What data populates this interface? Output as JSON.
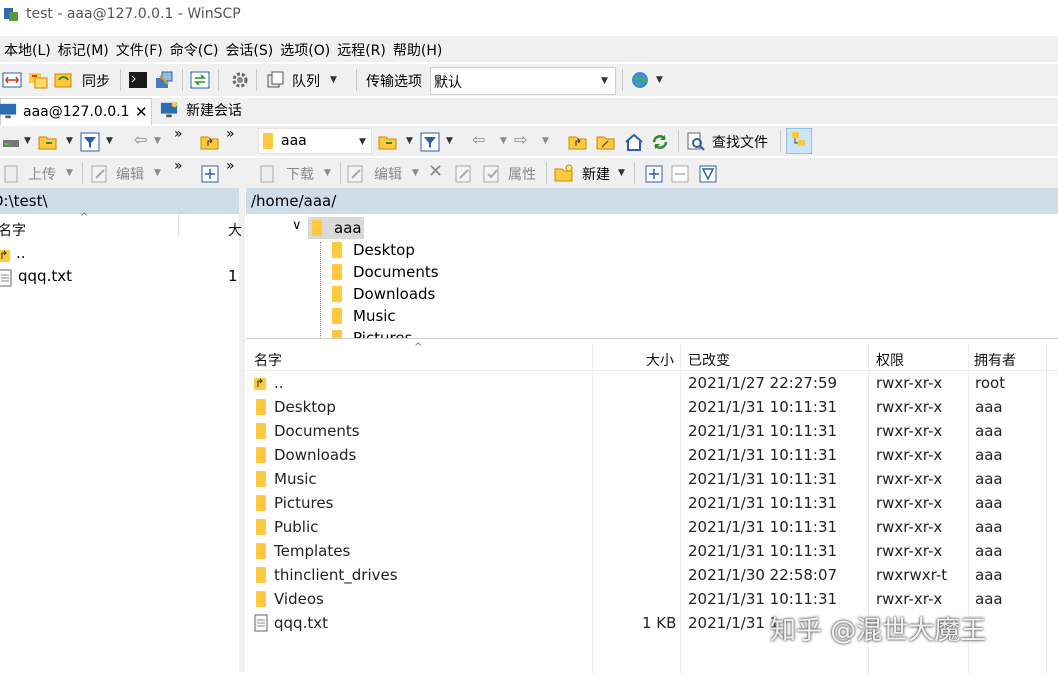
{
  "window": {
    "title": "test - aaa@127.0.0.1 - WinSCP"
  },
  "menu": [
    "本地(L)",
    "标记(M)",
    "文件(F)",
    "命令(C)",
    "会话(S)",
    "选项(O)",
    "远程(R)",
    "帮助(H)"
  ],
  "toolbar": {
    "sync_label": "同步",
    "queue_label": "队列",
    "transfer_label": "传输选项",
    "transfer_value": "默认"
  },
  "tabs": {
    "session": "aaa@127.0.0.1",
    "new_session": "新建会话"
  },
  "left_toolbar": {
    "upload": "上传",
    "edit": "编辑"
  },
  "right_toolbar": {
    "dir_value": "aaa",
    "find_files": "查找文件",
    "download": "下载",
    "edit": "编辑",
    "properties": "属性",
    "new": "新建"
  },
  "left_panel": {
    "path": "D:\\test\\",
    "col_name": "名字",
    "col_size_partial": "大",
    "rows": [
      {
        "name": "..",
        "size": ""
      },
      {
        "name": "qqq.txt",
        "size": "1"
      }
    ]
  },
  "tree": {
    "root": "aaa",
    "children": [
      "Desktop",
      "Documents",
      "Downloads",
      "Music",
      "Pictures"
    ]
  },
  "right_panel": {
    "path": "/home/aaa/",
    "columns": {
      "name": "名字",
      "size": "大小",
      "changed": "已改变",
      "rights": "权限",
      "owner": "拥有者"
    },
    "rows": [
      {
        "name": "..",
        "size": "",
        "changed": "2021/1/27 22:27:59",
        "rights": "rwxr-xr-x",
        "owner": "root"
      },
      {
        "name": "Desktop",
        "size": "",
        "changed": "2021/1/31 10:11:31",
        "rights": "rwxr-xr-x",
        "owner": "aaa"
      },
      {
        "name": "Documents",
        "size": "",
        "changed": "2021/1/31 10:11:31",
        "rights": "rwxr-xr-x",
        "owner": "aaa"
      },
      {
        "name": "Downloads",
        "size": "",
        "changed": "2021/1/31 10:11:31",
        "rights": "rwxr-xr-x",
        "owner": "aaa"
      },
      {
        "name": "Music",
        "size": "",
        "changed": "2021/1/31 10:11:31",
        "rights": "rwxr-xr-x",
        "owner": "aaa"
      },
      {
        "name": "Pictures",
        "size": "",
        "changed": "2021/1/31 10:11:31",
        "rights": "rwxr-xr-x",
        "owner": "aaa"
      },
      {
        "name": "Public",
        "size": "",
        "changed": "2021/1/31 10:11:31",
        "rights": "rwxr-xr-x",
        "owner": "aaa"
      },
      {
        "name": "Templates",
        "size": "",
        "changed": "2021/1/31 10:11:31",
        "rights": "rwxr-xr-x",
        "owner": "aaa"
      },
      {
        "name": "thinclient_drives",
        "size": "",
        "changed": "2021/1/30 22:58:07",
        "rights": "rwxrwxr-t",
        "owner": "aaa"
      },
      {
        "name": "Videos",
        "size": "",
        "changed": "2021/1/31 10:11:31",
        "rights": "rwxr-xr-x",
        "owner": "aaa"
      },
      {
        "name": "qqq.txt",
        "size": "1 KB",
        "changed": "2021/1/31 1",
        "rights": "",
        "owner": ""
      }
    ]
  },
  "watermark": "知乎 @混世大魔王"
}
